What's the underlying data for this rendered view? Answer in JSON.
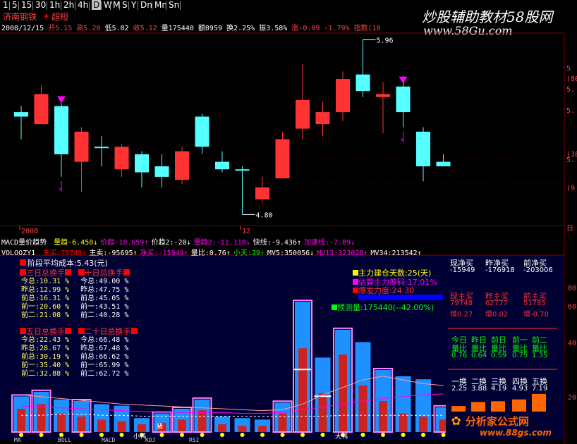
{
  "stock": {
    "name": "济南钢铁",
    "flag": "超短",
    "date": "2008/12/15",
    "open": "开5.15",
    "high": "高5.20",
    "low": "低5.02",
    "close": "收5.12",
    "volume": "量175440",
    "amount": "额8959",
    "turnover": "换2.25%",
    "amplitude": "振3.58%",
    "change": "涨-0.09",
    "change_pct": "-1.79%",
    "index": "指数(10"
  },
  "toolbar": {
    "timeframes": [
      "1",
      "5",
      "15",
      "30",
      "1h",
      "2h",
      "4h",
      "D",
      "W",
      "M",
      "S",
      "Y",
      "Dn",
      "Mn",
      "Sn"
    ],
    "active": "D"
  },
  "watermark": {
    "title": "炒股辅助教材58股网",
    "url": "www.58Gu.com"
  },
  "price_chart": {
    "high_label": "5.96",
    "low_label": "4.80",
    "year_label": "2008",
    "month_label": "12",
    "right_ticks": [
      "5",
      "(80.",
      "5.",
      "5.",
      "(38.",
      "5.",
      "(9",
      "日"
    ],
    "candles": [
      {
        "o": 5.48,
        "c": 5.45,
        "h": 5.52,
        "l": 5.3,
        "up": false
      },
      {
        "o": 5.4,
        "c": 5.6,
        "h": 5.66,
        "l": 5.4,
        "up": true
      },
      {
        "o": 5.52,
        "c": 5.2,
        "h": 5.55,
        "l": 5.05,
        "up": false
      },
      {
        "o": 5.35,
        "c": 5.15,
        "h": 5.38,
        "l": 4.95,
        "up": true
      },
      {
        "o": 5.25,
        "c": 5.25,
        "h": 5.32,
        "l": 5.12,
        "up": false
      },
      {
        "o": 5.25,
        "c": 5.1,
        "h": 5.27,
        "l": 5.05,
        "up": true
      },
      {
        "o": 5.08,
        "c": 5.2,
        "h": 5.22,
        "l": 4.98,
        "up": false
      },
      {
        "o": 5.12,
        "c": 5.05,
        "h": 5.2,
        "l": 4.98,
        "up": false
      },
      {
        "o": 5.03,
        "c": 5.22,
        "h": 5.25,
        "l": 5.0,
        "up": true
      },
      {
        "o": 5.45,
        "c": 5.25,
        "h": 5.47,
        "l": 5.2,
        "up": false
      },
      {
        "o": 5.15,
        "c": 5.1,
        "h": 5.22,
        "l": 5.08,
        "up": false
      },
      {
        "o": 5.1,
        "c": 5.1,
        "h": 5.12,
        "l": 4.8,
        "up": false
      },
      {
        "o": 4.98,
        "c": 4.9,
        "h": 5.05,
        "l": 4.88,
        "up": true
      },
      {
        "o": 5.04,
        "c": 5.3,
        "h": 5.35,
        "l": 5.04,
        "up": true
      },
      {
        "o": 5.37,
        "c": 5.56,
        "h": 5.8,
        "l": 5.3,
        "up": true
      },
      {
        "o": 5.4,
        "c": 5.48,
        "h": 5.55,
        "l": 5.32,
        "up": true
      },
      {
        "o": 5.48,
        "c": 5.7,
        "h": 5.75,
        "l": 5.42,
        "up": true
      },
      {
        "o": 5.73,
        "c": 5.62,
        "h": 5.96,
        "l": 5.58,
        "up": false
      },
      {
        "o": 5.6,
        "c": 5.58,
        "h": 5.68,
        "l": 5.34,
        "up": true
      },
      {
        "o": 5.48,
        "c": 5.65,
        "h": 5.72,
        "l": 5.38,
        "up": false
      },
      {
        "o": 5.35,
        "c": 5.12,
        "h": 5.38,
        "l": 5.02,
        "up": false
      },
      {
        "o": 5.12,
        "c": 5.15,
        "h": 5.2,
        "l": 5.12,
        "up": false
      }
    ],
    "signal_candles": [
      2,
      19
    ]
  },
  "macd_line": {
    "name": "MACD量价趋势",
    "items": [
      {
        "t": "量趋-6.450↓",
        "c": "#ffff00"
      },
      {
        "t": "价趋-18.659↑",
        "c": "#ff00ff"
      },
      {
        "t": "价趋2:-20↓",
        "c": "#ffffff"
      },
      {
        "t": "量趋2:-11.118↓",
        "c": "#ff00ff"
      },
      {
        "t": "快线:-9.436↑",
        "c": "#ffffff"
      },
      {
        "t": "加速线:-7.89↓",
        "c": "#ff00ff"
      }
    ]
  },
  "vol_line": {
    "name": "VOLOOZY1",
    "items": [
      {
        "t": "主买:79748↑",
        "c": "#ff0000"
      },
      {
        "t": "主卖:-95695↑",
        "c": "#ffffff"
      },
      {
        "t": "净买:-15949↑",
        "c": "#ff00ff"
      },
      {
        "t": "量比:0.76↑",
        "c": "#ffffff"
      },
      {
        "t": "小天:29↑",
        "c": "#00ff00"
      },
      {
        "t": "MV5:350056↓",
        "c": "#ffffff"
      },
      {
        "t": "MV13:323028↑",
        "c": "#ff00ff"
      },
      {
        "t": "MV34:213542↑",
        "c": "#ffffff"
      }
    ]
  },
  "indicator": {
    "avg_cost": "阶段平均成本:5.43(元)",
    "box1_title": [
      "三日总换手",
      "十日总换手"
    ],
    "box1_rows": [
      [
        "今总:10.31 %",
        "今总:49.00 %"
      ],
      [
        "昨总:12.99 %",
        "昨总:47.75 %"
      ],
      [
        "前总:16.31 %",
        "前总:45.05 %"
      ],
      [
        "前一:20.60 %",
        "前一:43.51 %"
      ],
      [
        "前二:21.08 %",
        "前二:40.28 %"
      ]
    ],
    "box2_title": [
      "五日总换手",
      "二十日总换手"
    ],
    "box2_rows": [
      [
        "今总:22.43 %",
        "今总:66.48 %"
      ],
      [
        "昨总:28.67 %",
        "昨总:67.48 %"
      ],
      [
        "前总:30.19 %",
        "前总:66.62 %"
      ],
      [
        "前一:35.40 %",
        "前一:65.99 %"
      ],
      [
        "前二:32.88 %",
        "前二:62.72 %"
      ]
    ],
    "main_days": "主力建仓天数:25(天)",
    "main_chips": "估算主力筹码:17.01%",
    "burst": "爆发力度:24.30",
    "forecast": "预测量:175440(--42.00%)",
    "labels": [
      "小鸭",
      "猪",
      "大鸭"
    ],
    "net_buy_hdr": [
      "现净买",
      "昨净买",
      "前净买"
    ],
    "net_buy_val": [
      "-15949",
      "-176918",
      "-203006"
    ],
    "main_buy_hdr": [
      "现主买",
      "昨主买",
      "前主买"
    ],
    "main_buy_val": [
      "79748",
      "62777",
      "51785"
    ],
    "main_buy_ratio": [
      "增0.27",
      "增0.02",
      "增-0.70"
    ],
    "vr_hdr1": [
      "今日",
      "昨日",
      "前日",
      "前一",
      "前二"
    ],
    "vr_hdr2": [
      "量比",
      "量比",
      "量比",
      "量比",
      "量比"
    ],
    "vr_val": [
      "0.76",
      "0.64",
      "0.59",
      "0.75",
      "1.35"
    ],
    "turn_hdr": [
      "一换",
      "二换",
      "三换",
      "四换",
      "五换"
    ],
    "turn_val": [
      "2.25",
      "3.88",
      "4.19",
      "4.93",
      "7.19"
    ],
    "right_ticks": [
      "80",
      "60",
      "40",
      "20"
    ],
    "logo_text": "分析家公式网",
    "logo_url": "www.88gs.com"
  },
  "volume_bars": [
    {
      "v": 23,
      "r": 15,
      "box": true
    },
    {
      "v": 26,
      "r": 18,
      "box": true
    },
    {
      "v": 21,
      "r": 12,
      "box": false
    },
    {
      "v": 20,
      "r": 10,
      "box": true
    },
    {
      "v": 18,
      "r": 8,
      "box": false
    },
    {
      "v": 17,
      "r": 7,
      "box": false
    },
    {
      "v": 9,
      "r": 5,
      "box": false
    },
    {
      "v": 12,
      "r": 6,
      "box": true
    },
    {
      "v": 15,
      "r": 8,
      "box": true
    },
    {
      "v": 21,
      "r": 14,
      "box": true
    },
    {
      "v": 10,
      "r": 5,
      "box": false
    },
    {
      "v": 9,
      "r": 4,
      "box": false
    },
    {
      "v": 8,
      "r": 4,
      "box": false
    },
    {
      "v": 19,
      "r": 12,
      "box": true
    },
    {
      "v": 84,
      "r": 54,
      "box": true
    },
    {
      "v": 48,
      "r": 25,
      "box": false
    },
    {
      "v": 66,
      "r": 50,
      "box": true
    },
    {
      "v": 58,
      "r": 30,
      "box": false
    },
    {
      "v": 40,
      "r": 20,
      "box": true
    },
    {
      "v": 36,
      "r": 12,
      "box": false
    },
    {
      "v": 34,
      "r": 10,
      "box": false
    },
    {
      "v": 16,
      "r": 8,
      "box": true
    }
  ],
  "bottom_tabs": [
    "MA",
    "BOLL",
    "MACD",
    "KDJ",
    "RSI"
  ]
}
